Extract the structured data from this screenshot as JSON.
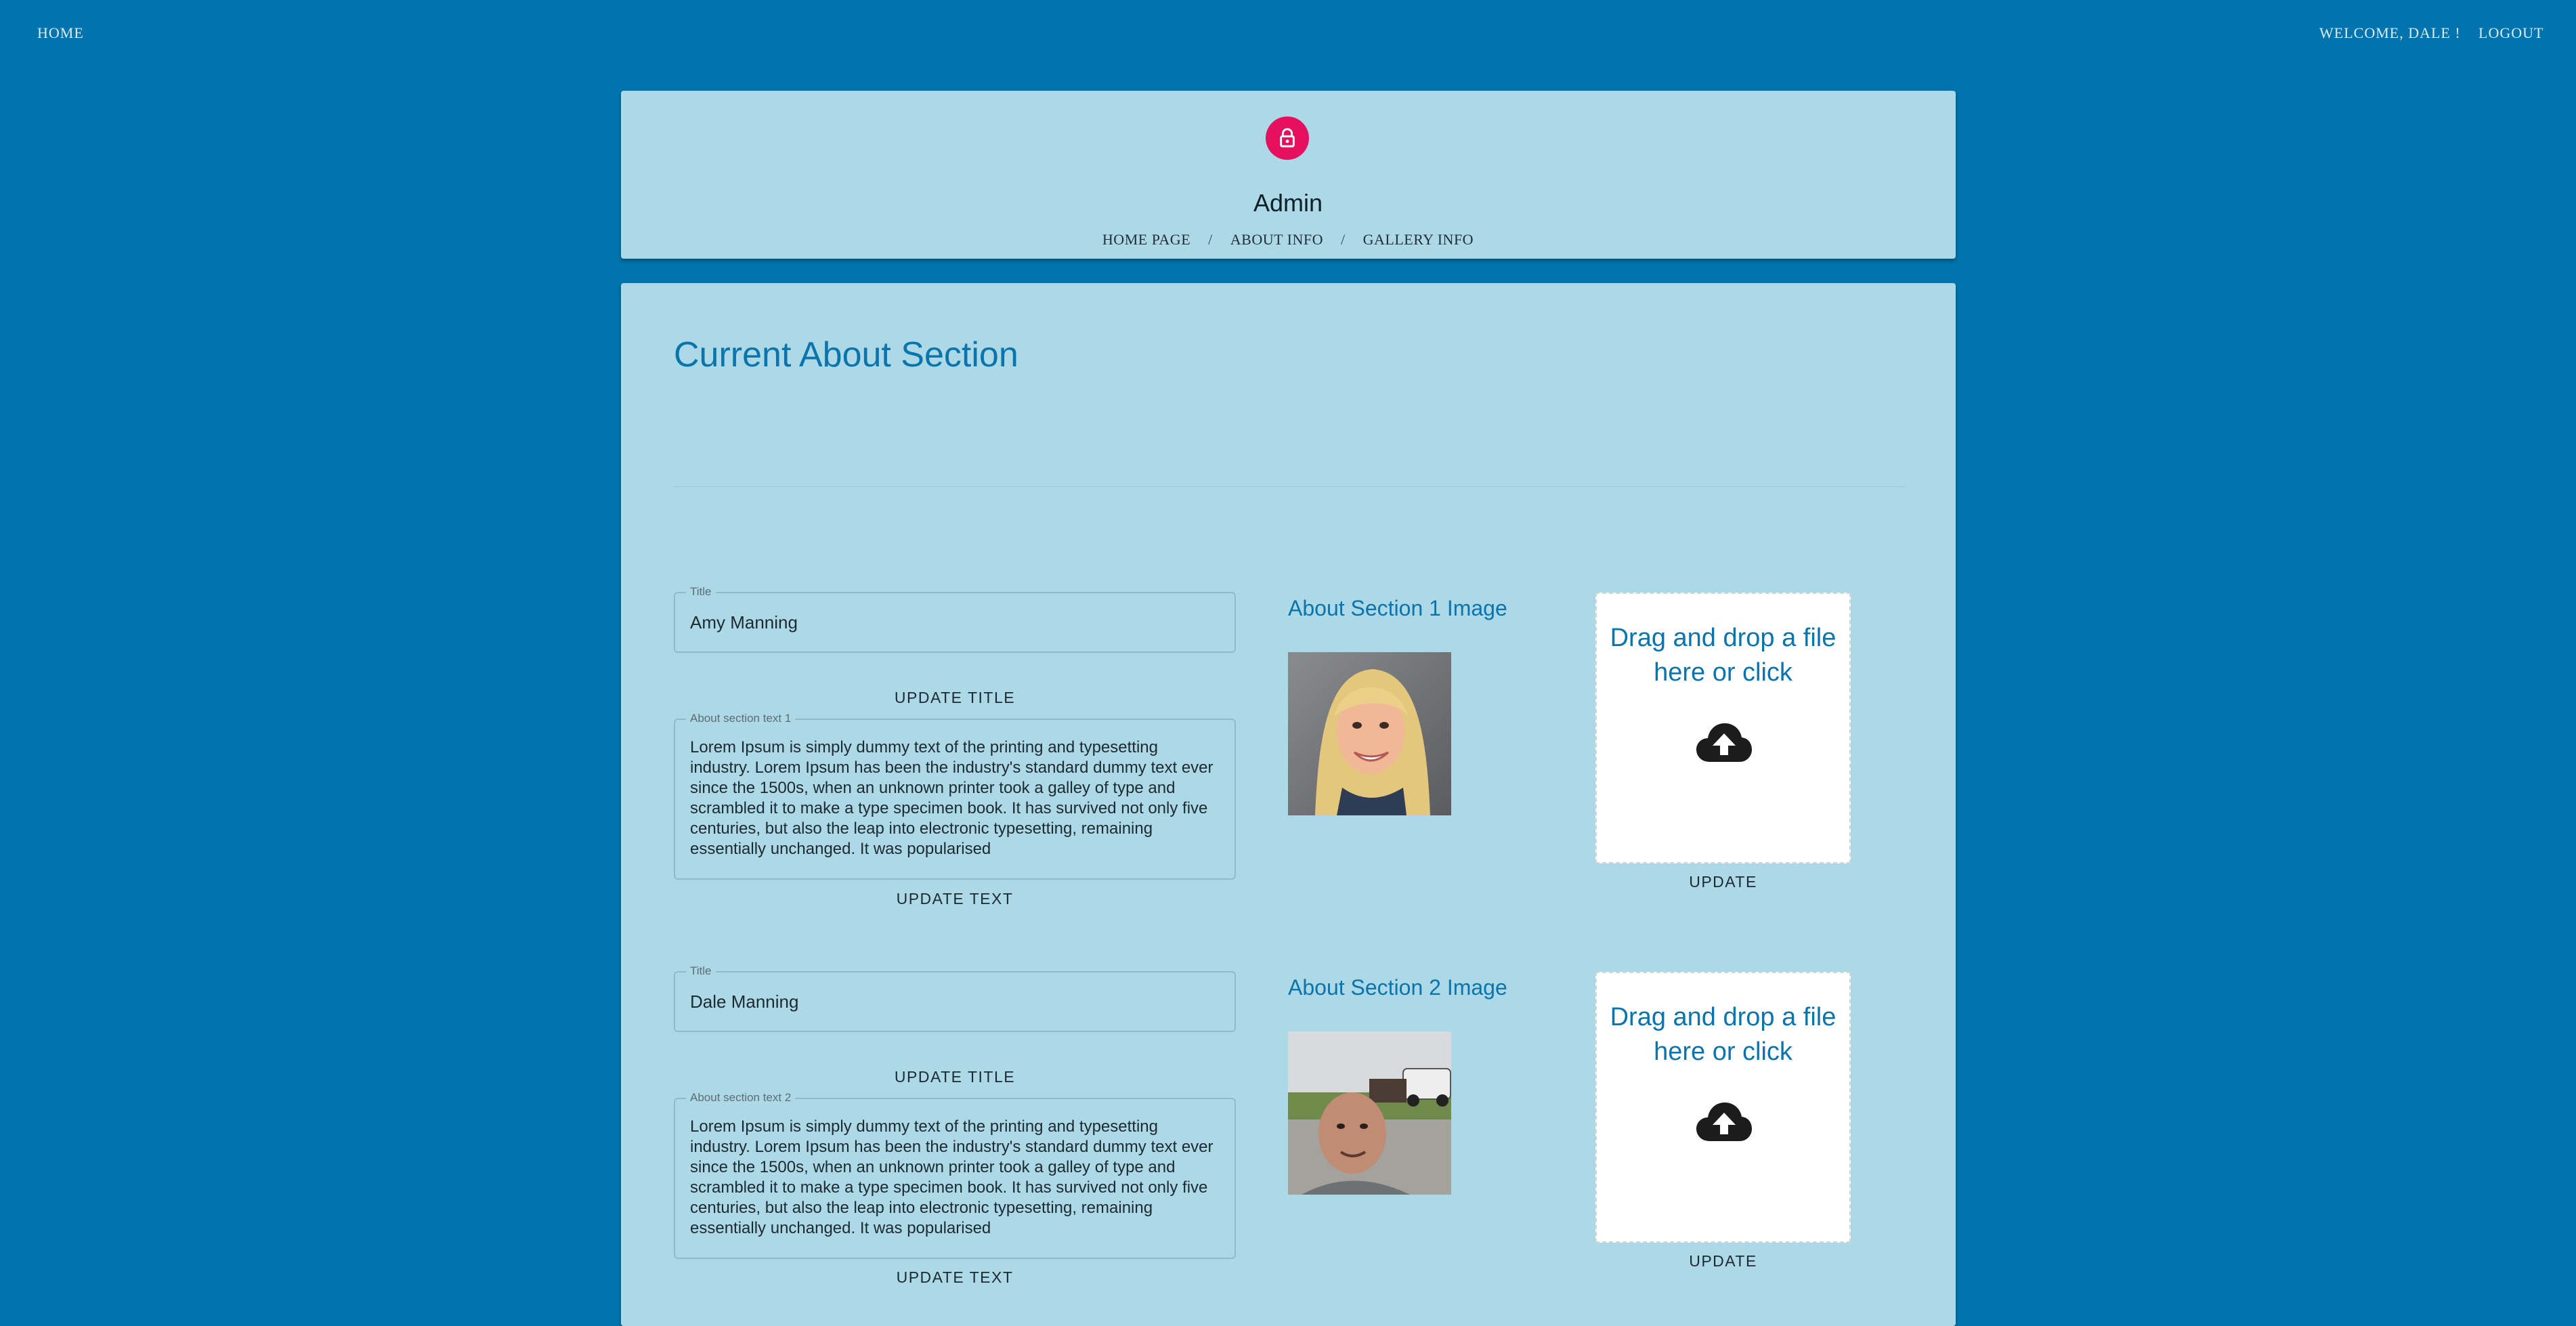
{
  "topnav": {
    "home": "HOME",
    "welcome": "WELCOME, DALE !",
    "logout": "LOGOUT"
  },
  "header": {
    "title": "Admin",
    "breadcrumbs": [
      {
        "label": "HOME PAGE"
      },
      {
        "label": "ABOUT INFO"
      },
      {
        "label": "GALLERY INFO"
      }
    ],
    "separator": "/"
  },
  "main": {
    "heading": "Current About Section",
    "sections": [
      {
        "title_label": "Title",
        "title_value": "Amy Manning",
        "update_title": "UPDATE TITLE",
        "text_label": "About section text 1",
        "text_value": "Lorem Ipsum is simply dummy text of the printing and typesetting industry. Lorem Ipsum has been the industry's standard dummy text ever since the 1500s, when an unknown printer took a galley of type and scrambled it to make a type specimen book. It has survived not only five centuries, but also the leap into electronic typesetting, remaining essentially unchanged. It was popularised",
        "update_text": "UPDATE TEXT",
        "image_heading": "About Section 1 Image",
        "dropzone_text": "Drag and drop a file here or click",
        "update_image": "UPDATE"
      },
      {
        "title_label": "Title",
        "title_value": "Dale Manning",
        "update_title": "UPDATE TITLE",
        "text_label": "About section text 2",
        "text_value": "Lorem Ipsum is simply dummy text of the printing and typesetting industry. Lorem Ipsum has been the industry's standard dummy text ever since the 1500s, when an unknown printer took a galley of type and scrambled it to make a type specimen book. It has survived not only five centuries, but also the leap into electronic typesetting, remaining essentially unchanged. It was popularised",
        "update_text": "UPDATE TEXT",
        "image_heading": "About Section 2 Image",
        "dropzone_text": "Drag and drop a file here or click",
        "update_image": "UPDATE"
      }
    ]
  },
  "icons": {
    "lock": "lock-icon",
    "upload": "cloud-upload-icon",
    "photo1": "woman-portrait-photo",
    "photo2": "man-portrait-photo"
  },
  "colors": {
    "background": "#0174ad",
    "card": "#add8e6",
    "accent": "#0a74ad",
    "avatar": "#e5105f"
  }
}
